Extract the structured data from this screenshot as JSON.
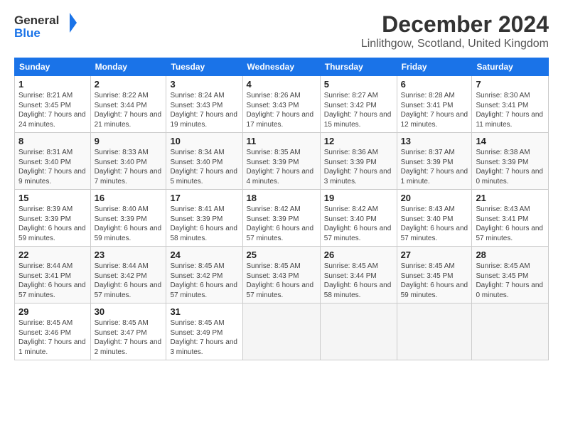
{
  "header": {
    "logo_general": "General",
    "logo_blue": "Blue",
    "title": "December 2024",
    "subtitle": "Linlithgow, Scotland, United Kingdom"
  },
  "weekdays": [
    "Sunday",
    "Monday",
    "Tuesday",
    "Wednesday",
    "Thursday",
    "Friday",
    "Saturday"
  ],
  "weeks": [
    [
      {
        "day": "1",
        "sunrise": "8:21 AM",
        "sunset": "3:45 PM",
        "daylight": "7 hours and 24 minutes."
      },
      {
        "day": "2",
        "sunrise": "8:22 AM",
        "sunset": "3:44 PM",
        "daylight": "7 hours and 21 minutes."
      },
      {
        "day": "3",
        "sunrise": "8:24 AM",
        "sunset": "3:43 PM",
        "daylight": "7 hours and 19 minutes."
      },
      {
        "day": "4",
        "sunrise": "8:26 AM",
        "sunset": "3:43 PM",
        "daylight": "7 hours and 17 minutes."
      },
      {
        "day": "5",
        "sunrise": "8:27 AM",
        "sunset": "3:42 PM",
        "daylight": "7 hours and 15 minutes."
      },
      {
        "day": "6",
        "sunrise": "8:28 AM",
        "sunset": "3:41 PM",
        "daylight": "7 hours and 12 minutes."
      },
      {
        "day": "7",
        "sunrise": "8:30 AM",
        "sunset": "3:41 PM",
        "daylight": "7 hours and 11 minutes."
      }
    ],
    [
      {
        "day": "8",
        "sunrise": "8:31 AM",
        "sunset": "3:40 PM",
        "daylight": "7 hours and 9 minutes."
      },
      {
        "day": "9",
        "sunrise": "8:33 AM",
        "sunset": "3:40 PM",
        "daylight": "7 hours and 7 minutes."
      },
      {
        "day": "10",
        "sunrise": "8:34 AM",
        "sunset": "3:40 PM",
        "daylight": "7 hours and 5 minutes."
      },
      {
        "day": "11",
        "sunrise": "8:35 AM",
        "sunset": "3:39 PM",
        "daylight": "7 hours and 4 minutes."
      },
      {
        "day": "12",
        "sunrise": "8:36 AM",
        "sunset": "3:39 PM",
        "daylight": "7 hours and 3 minutes."
      },
      {
        "day": "13",
        "sunrise": "8:37 AM",
        "sunset": "3:39 PM",
        "daylight": "7 hours and 1 minute."
      },
      {
        "day": "14",
        "sunrise": "8:38 AM",
        "sunset": "3:39 PM",
        "daylight": "7 hours and 0 minutes."
      }
    ],
    [
      {
        "day": "15",
        "sunrise": "8:39 AM",
        "sunset": "3:39 PM",
        "daylight": "6 hours and 59 minutes."
      },
      {
        "day": "16",
        "sunrise": "8:40 AM",
        "sunset": "3:39 PM",
        "daylight": "6 hours and 59 minutes."
      },
      {
        "day": "17",
        "sunrise": "8:41 AM",
        "sunset": "3:39 PM",
        "daylight": "6 hours and 58 minutes."
      },
      {
        "day": "18",
        "sunrise": "8:42 AM",
        "sunset": "3:39 PM",
        "daylight": "6 hours and 57 minutes."
      },
      {
        "day": "19",
        "sunrise": "8:42 AM",
        "sunset": "3:40 PM",
        "daylight": "6 hours and 57 minutes."
      },
      {
        "day": "20",
        "sunrise": "8:43 AM",
        "sunset": "3:40 PM",
        "daylight": "6 hours and 57 minutes."
      },
      {
        "day": "21",
        "sunrise": "8:43 AM",
        "sunset": "3:41 PM",
        "daylight": "6 hours and 57 minutes."
      }
    ],
    [
      {
        "day": "22",
        "sunrise": "8:44 AM",
        "sunset": "3:41 PM",
        "daylight": "6 hours and 57 minutes."
      },
      {
        "day": "23",
        "sunrise": "8:44 AM",
        "sunset": "3:42 PM",
        "daylight": "6 hours and 57 minutes."
      },
      {
        "day": "24",
        "sunrise": "8:45 AM",
        "sunset": "3:42 PM",
        "daylight": "6 hours and 57 minutes."
      },
      {
        "day": "25",
        "sunrise": "8:45 AM",
        "sunset": "3:43 PM",
        "daylight": "6 hours and 57 minutes."
      },
      {
        "day": "26",
        "sunrise": "8:45 AM",
        "sunset": "3:44 PM",
        "daylight": "6 hours and 58 minutes."
      },
      {
        "day": "27",
        "sunrise": "8:45 AM",
        "sunset": "3:45 PM",
        "daylight": "6 hours and 59 minutes."
      },
      {
        "day": "28",
        "sunrise": "8:45 AM",
        "sunset": "3:45 PM",
        "daylight": "7 hours and 0 minutes."
      }
    ],
    [
      {
        "day": "29",
        "sunrise": "8:45 AM",
        "sunset": "3:46 PM",
        "daylight": "7 hours and 1 minute."
      },
      {
        "day": "30",
        "sunrise": "8:45 AM",
        "sunset": "3:47 PM",
        "daylight": "7 hours and 2 minutes."
      },
      {
        "day": "31",
        "sunrise": "8:45 AM",
        "sunset": "3:49 PM",
        "daylight": "7 hours and 3 minutes."
      },
      null,
      null,
      null,
      null
    ]
  ]
}
